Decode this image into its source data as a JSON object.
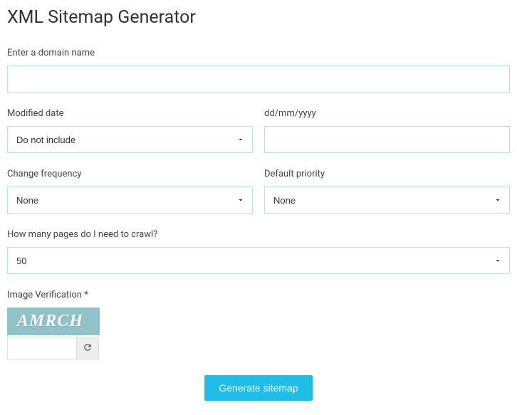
{
  "page_title": "XML Sitemap Generator",
  "domain_label": "Enter a domain name",
  "domain_value": "",
  "modified_date_label": "Modified date",
  "modified_date_value": "Do not include",
  "date_label": "dd/mm/yyyy",
  "date_value": "",
  "change_freq_label": "Change frequency",
  "change_freq_value": "None",
  "priority_label": "Default priority",
  "priority_value": "None",
  "pages_label": "How many pages do I need to crawl?",
  "pages_value": "50",
  "captcha_label": "Image Verification *",
  "captcha_text": "AMRCH",
  "captcha_value": "",
  "submit_label": "Generate sitemap"
}
